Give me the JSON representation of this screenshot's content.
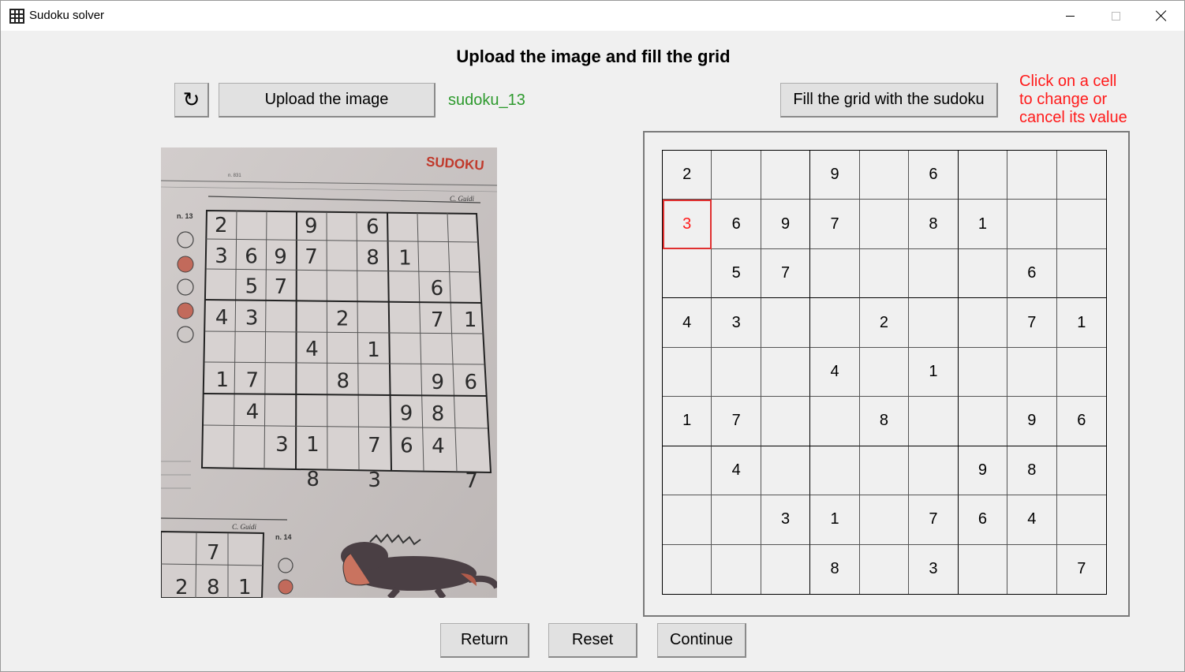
{
  "window": {
    "title": "Sudoku solver"
  },
  "heading": "Upload the image and fill the grid",
  "toolbar": {
    "refresh_icon": "↻",
    "upload_label": "Upload the image",
    "filename": "sudoku_13",
    "fill_label": "Fill the grid with the sudoku"
  },
  "hint": {
    "line1": "Click on a cell",
    "line2": "to change or",
    "line3": "cancel its value",
    "color": "#ff1a1a"
  },
  "photo": {
    "publication": "SUDOKU",
    "author": "C. Guidi",
    "puzzle_label": "n. 13",
    "next_puzzle_label": "n. 14",
    "issue": "n. 831",
    "next_author": "C. Guidi",
    "next_row1": [
      "",
      "7",
      ""
    ],
    "next_row2": [
      "2",
      "8",
      "1"
    ]
  },
  "grid": {
    "rows": [
      [
        "2",
        "",
        "",
        "9",
        "",
        "6",
        "",
        "",
        ""
      ],
      [
        "3",
        "6",
        "9",
        "7",
        "",
        "8",
        "1",
        "",
        ""
      ],
      [
        "",
        "5",
        "7",
        "",
        "",
        "",
        "",
        "6",
        ""
      ],
      [
        "4",
        "3",
        "",
        "",
        "2",
        "",
        "",
        "7",
        "1"
      ],
      [
        "",
        "",
        "",
        "4",
        "",
        "1",
        "",
        "",
        ""
      ],
      [
        "1",
        "7",
        "",
        "",
        "8",
        "",
        "",
        "9",
        "6"
      ],
      [
        "",
        "4",
        "",
        "",
        "",
        "",
        "9",
        "8",
        ""
      ],
      [
        "",
        "",
        "3",
        "1",
        "",
        "7",
        "6",
        "4",
        ""
      ],
      [
        "",
        "",
        "",
        "8",
        "",
        "3",
        "",
        "",
        "7"
      ]
    ],
    "selected_row": 1,
    "selected_col": 0
  },
  "footer": {
    "return_label": "Return",
    "reset_label": "Reset",
    "continue_label": "Continue"
  }
}
